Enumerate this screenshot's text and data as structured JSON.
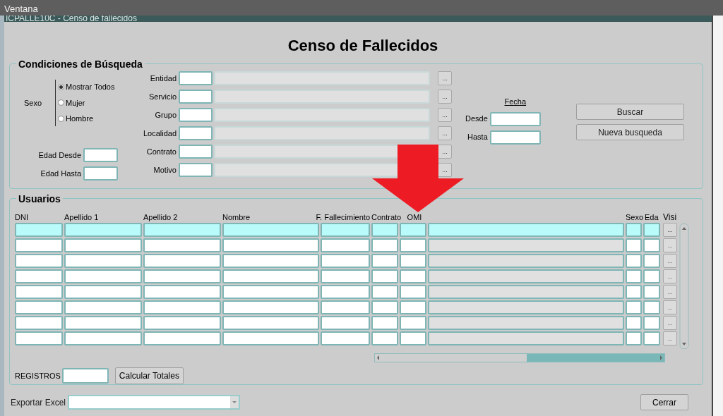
{
  "menu": [
    "Ventana"
  ],
  "window_title": "ICPALLE10C - Censo de fallecidos",
  "heading": "Censo de Fallecidos",
  "search": {
    "title": "Condiciones de Búsqueda",
    "sexo": {
      "label": "Sexo",
      "options": [
        {
          "label": "Mostrar Todos",
          "selected": true
        },
        {
          "label": "Mujer",
          "selected": false
        },
        {
          "label": "Hombre",
          "selected": false
        }
      ]
    },
    "edad": [
      {
        "label": "Edad Desde"
      },
      {
        "label": "Edad Hasta"
      }
    ],
    "lookups": [
      {
        "label": "Entidad",
        "button": "..."
      },
      {
        "label": "Servicio",
        "button": "..."
      },
      {
        "label": "Grupo",
        "button": "..."
      },
      {
        "label": "Localidad",
        "button": "..."
      },
      {
        "label": "Contrato",
        "button": "..."
      },
      {
        "label": "Motivo",
        "button": "..."
      }
    ],
    "fecha": {
      "title": "Fecha",
      "fields": [
        {
          "label": "Desde"
        },
        {
          "label": "Hasta"
        }
      ]
    },
    "buttons": [
      "Buscar",
      "Nueva busqueda"
    ]
  },
  "usuarios": {
    "title": "Usuarios",
    "columns": [
      {
        "label": "DNI",
        "kind": "field"
      },
      {
        "label": "Apellido 1",
        "kind": "field"
      },
      {
        "label": "Apellido 2",
        "kind": "field"
      },
      {
        "label": "Nombre",
        "kind": "field"
      },
      {
        "label": "F. Fallecimiento",
        "kind": "field"
      },
      {
        "label": "Contrato",
        "kind": "field"
      },
      {
        "label": "OMI",
        "kind": "field"
      },
      {
        "kind": "readonly"
      },
      {
        "label": "Sexo",
        "kind": "field"
      },
      {
        "label": "Eda",
        "kind": "field"
      }
    ],
    "action_column": {
      "label": "Visi",
      "button": "..."
    },
    "rows": [
      {
        "selected": true,
        "disabled": false
      },
      {
        "selected": false,
        "disabled": true
      },
      {
        "selected": false,
        "disabled": true
      },
      {
        "selected": false,
        "disabled": true
      },
      {
        "selected": false,
        "disabled": true
      },
      {
        "selected": false,
        "disabled": true
      },
      {
        "selected": false,
        "disabled": true
      },
      {
        "selected": false,
        "disabled": true
      }
    ],
    "registros_label": "REGISTROS",
    "totals_button": "Calcular Totales"
  },
  "export": {
    "label": "Exportar Excel"
  },
  "close_button": "Cerrar"
}
